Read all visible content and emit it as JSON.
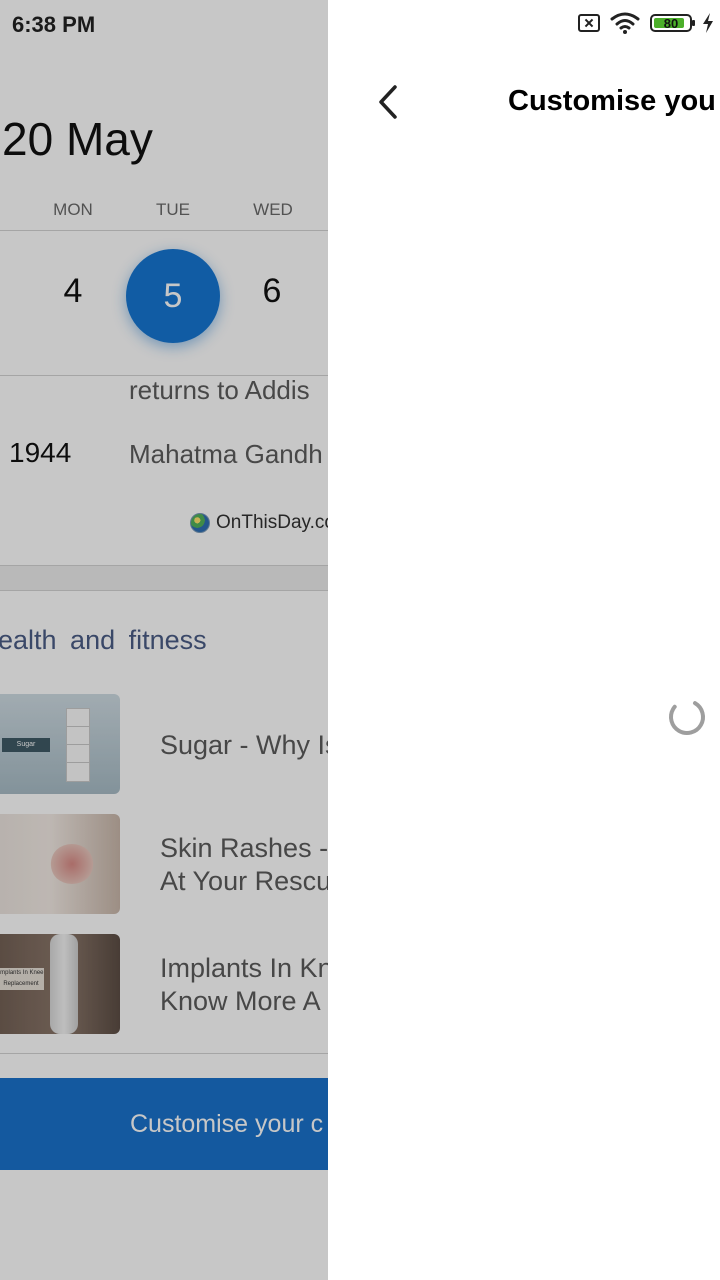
{
  "status_bar": {
    "time": "6:38 PM",
    "battery_level": "80"
  },
  "background_screen": {
    "date_title": "20 May",
    "weekdays": [
      "MON",
      "TUE",
      "WED"
    ],
    "days": [
      "4",
      "5",
      "6"
    ],
    "selected_day": "5",
    "events": [
      {
        "year": "",
        "text": "returns to Addis"
      },
      {
        "year": "1944",
        "text": "Mahatma Gandh"
      }
    ],
    "source": "OnThisDay.co",
    "section_title": "ealth and fitness",
    "articles": [
      {
        "title_lines": [
          "Sugar - Why Is"
        ],
        "thumb_text": "Sugar"
      },
      {
        "title_lines": [
          "Skin Rashes -",
          "At Your Rescu"
        ]
      },
      {
        "title_lines": [
          "Implants In Kn",
          "Know More A"
        ],
        "thumb_text": "Implants In Knee Replacement"
      }
    ],
    "cta_label": "Customise your c"
  },
  "panel": {
    "title": "Customise you"
  },
  "colors": {
    "accent": "#1677d2",
    "cta": "#1a73cc",
    "battery_fill": "#4caf2a",
    "section_title": "#4b5d86"
  }
}
